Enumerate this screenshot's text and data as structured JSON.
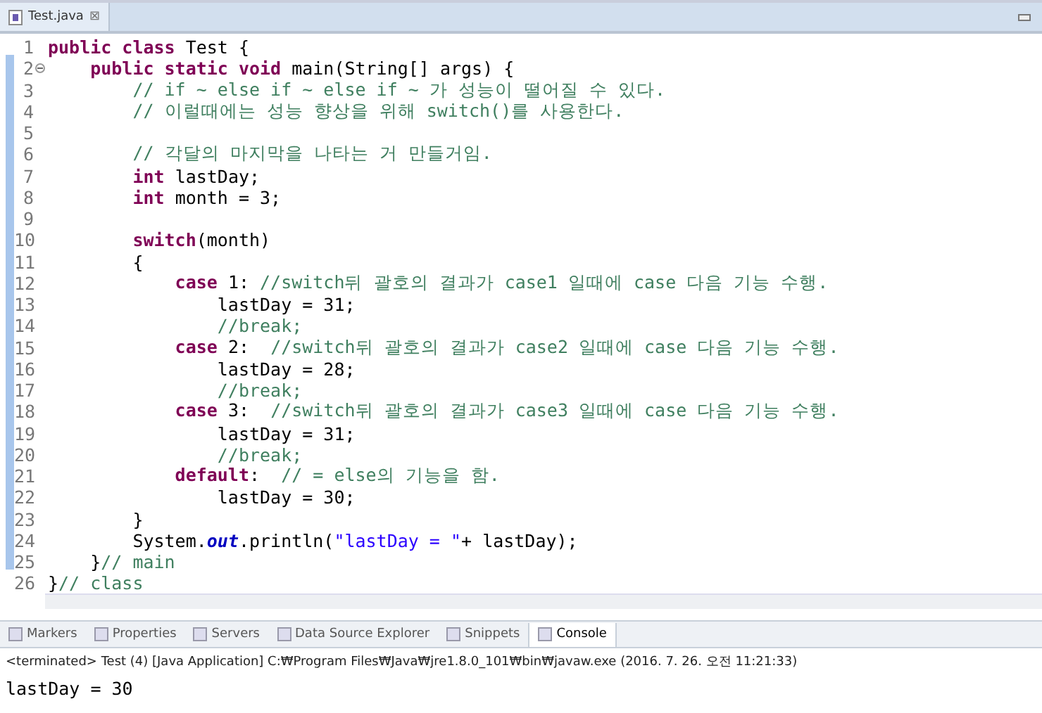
{
  "editor_tab": {
    "label": "Test.java",
    "close": "⊠"
  },
  "code": [
    {
      "number": "1",
      "fold": false,
      "tokens": [
        {
          "kind": "kw",
          "text": "public class"
        },
        {
          "kind": "plain",
          "text": " Test {"
        }
      ]
    },
    {
      "number": "2",
      "fold": true,
      "tokens": [
        {
          "kind": "kw",
          "text": "    public static void"
        },
        {
          "kind": "plain",
          "text": " main(String[] args) {"
        }
      ]
    },
    {
      "number": "3",
      "fold": false,
      "tokens": [
        {
          "kind": "comment",
          "text": "        // if ~ else if ~ else if ~ 가 성능이 떨어질 수 있다."
        }
      ]
    },
    {
      "number": "4",
      "fold": false,
      "tokens": [
        {
          "kind": "comment",
          "text": "        // 이럴때에는 성능 향상을 위해 switch()를 사용한다."
        }
      ]
    },
    {
      "number": "5",
      "fold": false
    },
    {
      "number": "6",
      "fold": false,
      "tokens": [
        {
          "kind": "comment",
          "text": "        // 각달의 마지막을 나타는 거 만들거임."
        }
      ]
    },
    {
      "number": "7",
      "fold": false,
      "tokens": [
        {
          "kind": "kw",
          "text": "        int"
        },
        {
          "kind": "plain",
          "text": " lastDay;"
        }
      ]
    },
    {
      "number": "8",
      "fold": false,
      "tokens": [
        {
          "kind": "kw",
          "text": "        int"
        },
        {
          "kind": "plain",
          "text": " month = 3;"
        }
      ]
    },
    {
      "number": "9",
      "fold": false
    },
    {
      "number": "10",
      "fold": false,
      "tokens": [
        {
          "kind": "kw",
          "text": "        switch"
        },
        {
          "kind": "plain",
          "text": "(month)"
        }
      ]
    },
    {
      "number": "11",
      "fold": false,
      "tokens": [
        {
          "kind": "plain",
          "text": "        {"
        }
      ]
    },
    {
      "number": "12",
      "fold": false,
      "tokens": [
        {
          "kind": "kw",
          "text": "            case"
        },
        {
          "kind": "plain",
          "text": " 1: "
        },
        {
          "kind": "comment",
          "text": "//switch뒤 괄호의 결과가 case1 일때에 case 다음 기능 수행."
        }
      ]
    },
    {
      "number": "13",
      "fold": false,
      "tokens": [
        {
          "kind": "plain",
          "text": "                lastDay = 31;"
        }
      ]
    },
    {
      "number": "14",
      "fold": false,
      "tokens": [
        {
          "kind": "comment",
          "text": "                //break;"
        }
      ]
    },
    {
      "number": "15",
      "fold": false,
      "tokens": [
        {
          "kind": "kw",
          "text": "            case"
        },
        {
          "kind": "plain",
          "text": " 2:  "
        },
        {
          "kind": "comment",
          "text": "//switch뒤 괄호의 결과가 case2 일때에 case 다음 기능 수행."
        }
      ]
    },
    {
      "number": "16",
      "fold": false,
      "tokens": [
        {
          "kind": "plain",
          "text": "                lastDay = 28;"
        }
      ]
    },
    {
      "number": "17",
      "fold": false,
      "tokens": [
        {
          "kind": "comment",
          "text": "                //break;"
        }
      ]
    },
    {
      "number": "18",
      "fold": false,
      "tokens": [
        {
          "kind": "kw",
          "text": "            case"
        },
        {
          "kind": "plain",
          "text": " 3:  "
        },
        {
          "kind": "comment",
          "text": "//switch뒤 괄호의 결과가 case3 일때에 case 다음 기능 수행."
        }
      ]
    },
    {
      "number": "19",
      "fold": false,
      "tokens": [
        {
          "kind": "plain",
          "text": "                lastDay = 31;"
        }
      ]
    },
    {
      "number": "20",
      "fold": false,
      "tokens": [
        {
          "kind": "comment",
          "text": "                //break;"
        }
      ]
    },
    {
      "number": "21",
      "fold": false,
      "tokens": [
        {
          "kind": "kw",
          "text": "            default"
        },
        {
          "kind": "plain",
          "text": ":  "
        },
        {
          "kind": "comment",
          "text": "// = else의 기능을 함."
        }
      ]
    },
    {
      "number": "22",
      "fold": false,
      "tokens": [
        {
          "kind": "plain",
          "text": "                lastDay = 30;"
        }
      ]
    },
    {
      "number": "23",
      "fold": false,
      "tokens": [
        {
          "kind": "plain",
          "text": "        }"
        }
      ]
    },
    {
      "number": "24",
      "fold": false,
      "tokens": [
        {
          "kind": "plain",
          "text": "        System."
        },
        {
          "kind": "field",
          "text": "out"
        },
        {
          "kind": "plain",
          "text": ".println("
        },
        {
          "kind": "string",
          "text": "\"lastDay = \""
        },
        {
          "kind": "plain",
          "text": "+ lastDay);"
        }
      ]
    },
    {
      "number": "25",
      "fold": false,
      "tokens": [
        {
          "kind": "plain",
          "text": "    }"
        },
        {
          "kind": "comment",
          "text": "// main"
        }
      ]
    },
    {
      "number": "26",
      "fold": false,
      "tokens": [
        {
          "kind": "plain",
          "text": "}"
        },
        {
          "kind": "comment",
          "text": "// class"
        }
      ]
    }
  ],
  "bottom_tabs": [
    {
      "label": "Markers",
      "selected": false
    },
    {
      "label": "Properties",
      "selected": false
    },
    {
      "label": "Servers",
      "selected": false
    },
    {
      "label": "Data Source Explorer",
      "selected": false
    },
    {
      "label": "Snippets",
      "selected": false
    },
    {
      "label": "Console",
      "selected": true
    }
  ],
  "console": {
    "header": "<terminated> Test (4) [Java Application] C:₩Program Files₩Java₩jre1.8.0_101₩bin₩javaw.exe (2016. 7. 26. 오전 11:21:33)",
    "output": "lastDay = 30"
  }
}
